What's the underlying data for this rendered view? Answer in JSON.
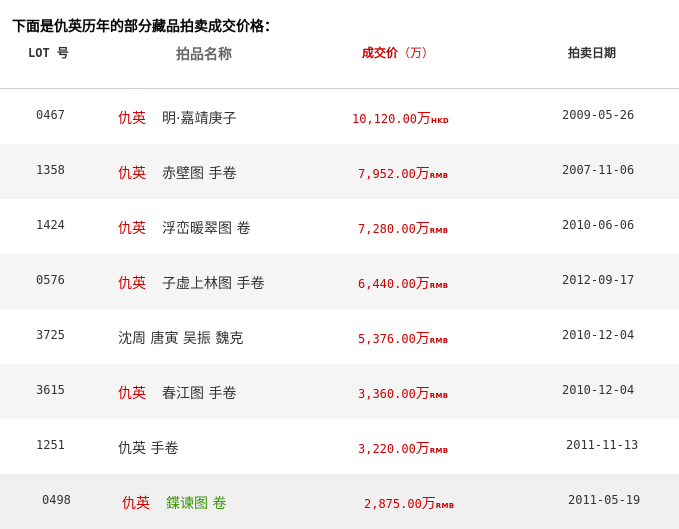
{
  "heading": "下面是仇英历年的部分藏品拍卖成交价格：",
  "columns": {
    "lot": "LOT 号",
    "name": "拍品名称",
    "price": "成交价",
    "price_unit": "（万）",
    "date": "拍卖日期"
  },
  "colors": {
    "artist_red": "#cc0000",
    "price_red": "#cc0000",
    "work_green": "#339900",
    "row_alt_bg": "#f5f5f5"
  },
  "rows": [
    {
      "lot": "0467",
      "artist": "仇英",
      "work": "明·嘉靖庚子",
      "price": "10,120.00",
      "unit": "万",
      "currency": "HKD",
      "date": "2009-05-26"
    },
    {
      "lot": "1358",
      "artist": "仇英",
      "work": "赤壁图 手卷",
      "price": "7,952.00",
      "unit": "万",
      "currency": "RMB",
      "date": "2007-11-06"
    },
    {
      "lot": "1424",
      "artist": "仇英",
      "work": "浮峦暖翠图 卷",
      "price": "7,280.00",
      "unit": "万",
      "currency": "RMB",
      "date": "2010-06-06"
    },
    {
      "lot": "0576",
      "artist": "仇英",
      "work": "子虚上林图 手卷",
      "price": "6,440.00",
      "unit": "万",
      "currency": "RMB",
      "date": "2012-09-17"
    },
    {
      "lot": "3725",
      "artist": "沈周 唐寅 吴振 魏克",
      "work": "",
      "price": "5,376.00",
      "unit": "万",
      "currency": "RMB",
      "date": "2010-12-04"
    },
    {
      "lot": "3615",
      "artist": "仇英",
      "work": "春江图 手卷",
      "price": "3,360.00",
      "unit": "万",
      "currency": "RMB",
      "date": "2010-12-04"
    },
    {
      "lot": "1251",
      "artist": "仇英 手卷",
      "work": "",
      "price": "3,220.00",
      "unit": "万",
      "currency": "RMB",
      "date": "2011-11-13"
    },
    {
      "lot": "0498",
      "artist": "仇英",
      "work": "鍱谏图 卷",
      "price": "2,875.00",
      "unit": "万",
      "currency": "RMB",
      "date": "2011-05-19"
    }
  ]
}
